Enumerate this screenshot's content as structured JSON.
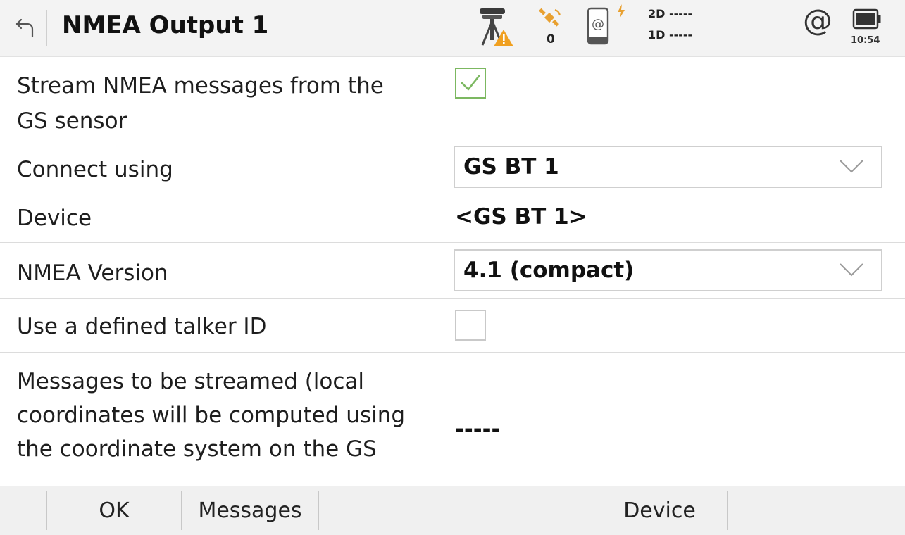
{
  "header": {
    "title": "NMEA Output 1",
    "satellite_count": "0",
    "precision_2d": "2D -----",
    "precision_1d": "1D -----",
    "internet_symbol": "@",
    "time": "10:54",
    "icons": [
      "back-arrow-icon",
      "gs-sensor-warning-icon",
      "satellite-icon",
      "device-internet-icon",
      "lightning-icon",
      "internet-at-icon",
      "battery-icon"
    ]
  },
  "form": {
    "stream": {
      "label_line1": "Stream NMEA messages from the",
      "label_line2": "GS sensor",
      "checked": true
    },
    "connect": {
      "label": "Connect using",
      "value": "GS BT 1"
    },
    "device": {
      "label": "Device",
      "value": "<GS BT 1>"
    },
    "version": {
      "label": "NMEA Version",
      "value": "4.1 (compact)"
    },
    "talker": {
      "label": "Use a defined talker ID",
      "checked": false
    },
    "messages": {
      "label_line1": "Messages to be streamed (local",
      "label_line2": "coordinates will be computed using",
      "label_line3": "the coordinate system on the GS",
      "value": "-----"
    }
  },
  "softkeys": {
    "ok": "OK",
    "messages": "Messages",
    "device": "Device"
  },
  "colors": {
    "accent_check": "#7cb861",
    "warning": "#f0a020",
    "satellite": "#e8a030"
  }
}
